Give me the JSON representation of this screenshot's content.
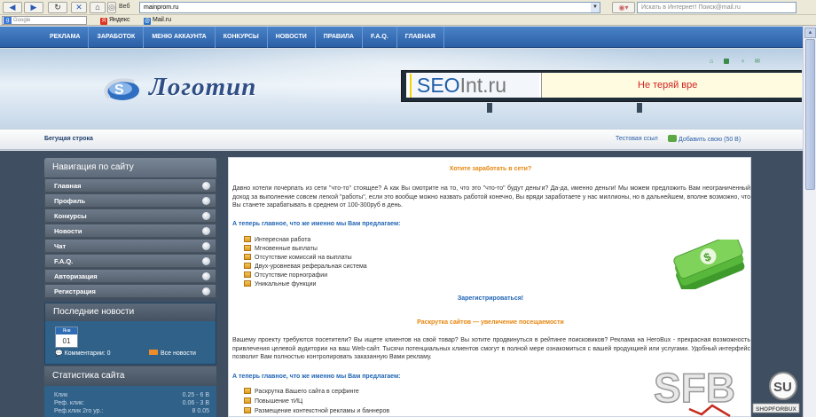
{
  "browser": {
    "web_label": "Веб",
    "address": "mainprom.ru",
    "search_placeholder": "Искать в Интернет! Поиск@mail.ru",
    "google_placeholder": "Google",
    "bookmarks": [
      "Яндекс",
      "Mail.ru"
    ]
  },
  "site_nav": [
    "РЕКЛАМА",
    "ЗАРАБОТОК",
    "МЕНЮ АККАУНТА",
    "КОНКУРСЫ",
    "НОВОСТИ",
    "ПРАВИЛА",
    "F.A.Q.",
    "ГЛАВНАЯ"
  ],
  "header": {
    "logo_text": "Логотип",
    "banner_seo": "SEO",
    "banner_int": "Int.ru",
    "banner_tagline": "Не теряй вре"
  },
  "running_line": {
    "label": "Бегущая строка",
    "test_link": "Тестовая ссыл",
    "add_link": "Добавить свою (50 В)"
  },
  "sidebar": {
    "nav_title": "Навигация по сайту",
    "nav_items": [
      "Главная",
      "Профиль",
      "Конкурсы",
      "Новости",
      "Чат",
      "F.A.Q.",
      "Авторизация",
      "Регистрация"
    ],
    "news_title": "Последние новости",
    "cal_month": "Янв",
    "cal_day": "01",
    "comments": "Комментарии: 0",
    "all_news": "Все новости",
    "stats_title": "Статистика сайта",
    "stats": [
      {
        "label": "Клик",
        "value": "0.25 - 6 В"
      },
      {
        "label": "Реф. клик:",
        "value": "0.06 - 3 В"
      },
      {
        "label": "Реф.клик 2го ур.:",
        "value": "8 0.05"
      }
    ]
  },
  "content": {
    "title1": "Хотите заработать в сети?",
    "para1": "Давно хотели почерпать из сети \"что-то\" стоящее? А как Вы смотрите на то, что это \"что-то\" будут деньги? Да-да, именно деньги! Мы можем предложить Вам неограниченный доход за выполнение совсем легкой \"работы\", если это вообще можно назвать работой конечно, Вы вряди заработаете у нас миллионы, но в дальнейшем, вполне возможно, что Вы станете зарабатывать в среднем от 100-300руб в день.",
    "sub1": "А теперь главное, что же именно мы Вам предлагаем:",
    "list1": [
      "Интересная работа",
      "Мгновенные выплаты",
      "Отсутствие комиссий на выплаты",
      "Двух-уровневая реферальная система",
      "Отсутствие порнографии",
      "Уникальные функции"
    ],
    "register": "Зарегистрироваться!",
    "title2": "Раскрутка сайтов — увеличение посещаемости",
    "para2": "Вашему проекту требуются посетители? Вы ищете клиентов на свой товар? Вы хотите продвинуться в рейтинге поисковиков? Реклама на HeroBux - прекрасная возможность привлечения целевой аудитории на ваш Web-сайт. Тысячи потенциальных клиентов смогут в полной мере ознакомиться с вашей продукцией или услугами. Удобный интерфейс позволит Вам полностью контролировать заказанную Вами рекламу.",
    "sub2": "А теперь главное, что же именно мы Вам предлагаем:",
    "list2": [
      "Раскрутка Вашего сайта в серфинге",
      "Повышение тИЦ",
      "Размещение контекстной рекламы и баннеров"
    ]
  },
  "watermark": {
    "letters": "SFB",
    "badge": "SU",
    "caption": "SHOPFORBUX"
  }
}
